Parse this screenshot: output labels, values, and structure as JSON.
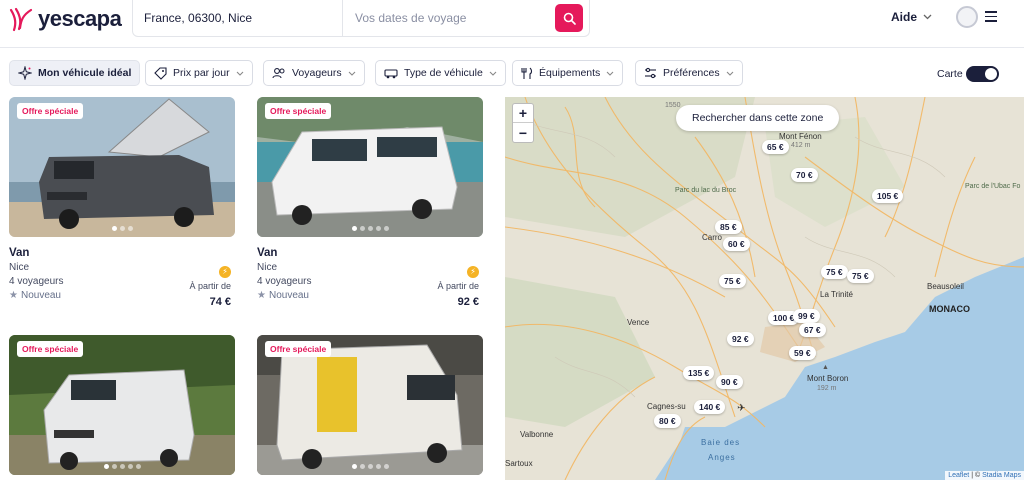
{
  "header": {
    "brand": "yescapa",
    "search_location": "France, 06300, Nice",
    "search_dates_placeholder": "Vos dates de voyage",
    "help_label": "Aide"
  },
  "filters": {
    "ideal_vehicle": "Mon véhicule idéal",
    "price": "Prix par jour",
    "travelers": "Voyageurs",
    "vehicle_type": "Type de véhicule",
    "equipment": "Équipements",
    "preferences": "Préférences",
    "map_toggle_label": "Carte",
    "map_toggle_on": true
  },
  "listings": [
    {
      "badge": "Offre spéciale",
      "title": "Van",
      "city": "Nice",
      "seats": "4 voyageurs",
      "tag": "Nouveau",
      "from_label": "À partir de",
      "price": "74 €",
      "instant_booking": true,
      "image_dots": 3
    },
    {
      "badge": "Offre spéciale",
      "title": "Van",
      "city": "Nice",
      "seats": "4 voyageurs",
      "tag": "Nouveau",
      "from_label": "À partir de",
      "price": "92 €",
      "instant_booking": true,
      "image_dots": 5
    },
    {
      "badge": "Offre spéciale",
      "image_dots": 5
    },
    {
      "badge": "Offre spéciale",
      "image_dots": 5
    }
  ],
  "map": {
    "search_zone_label": "Rechercher dans cette zone",
    "zoom_in": "+",
    "zoom_out": "−",
    "attribution_leaflet": "Leaflet",
    "attribution_sep": " | © ",
    "attribution_stadia": "Stadia Maps",
    "price_pins": [
      "65 €",
      "70 €",
      "105 €",
      "85 €",
      "60 €",
      "75 €",
      "75 €",
      "75 €",
      "100 €",
      "99 €",
      "67 €",
      "92 €",
      "59 €",
      "135 €",
      "90 €",
      "140 €",
      "80 €"
    ],
    "places": {
      "mont_fenon": "Mont Fénon",
      "mont_fenon_alt": "412 m",
      "parc_broc": "Parc du lac du Broc",
      "parc_ubac": "Parc de l'Ubac Fo",
      "carros": "Carro",
      "la_trinite": "La Trinité",
      "beausoleil": "Beausoleil",
      "monaco": "MONACO",
      "vence": "Vence",
      "mont_boron": "Mont Boron",
      "mont_boron_alt": "192 m",
      "cagnes": "Cagnes-su",
      "valbonne": "Valbonne",
      "sartoux": "Sartoux",
      "baie_line1": "Baie des",
      "baie_line2": "Anges",
      "alt_1550": "1550"
    }
  }
}
